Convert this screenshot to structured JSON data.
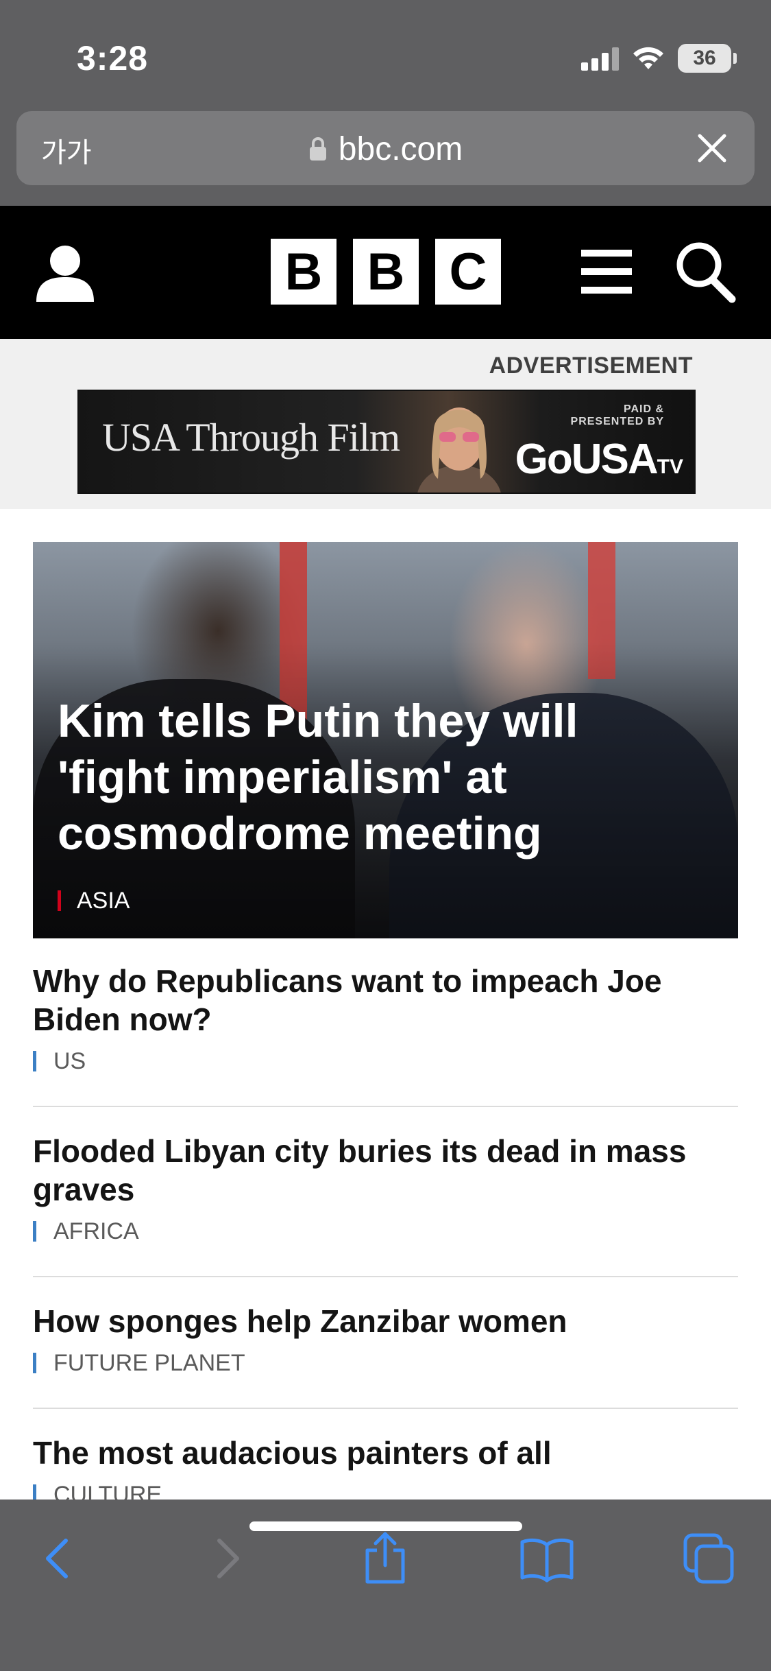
{
  "status_bar": {
    "time": "3:28",
    "battery": "36"
  },
  "browser": {
    "text_size_button": "가가",
    "url": "bbc.com"
  },
  "bbc": {
    "logo_letters": [
      "B",
      "B",
      "C"
    ]
  },
  "advertisement": {
    "label": "ADVERTISEMENT",
    "banner_title": "USA Through Film",
    "paid_line1": "PAID &",
    "paid_line2": "PRESENTED BY",
    "brand": "GoUSA",
    "brand_suffix": "TV"
  },
  "hero": {
    "title": "Kim tells Putin they will 'fight imperialism' at cosmodrome meeting",
    "tag": "ASIA"
  },
  "stories": [
    {
      "title": "Why do Republicans want to impeach Joe Biden now?",
      "tag": "US"
    },
    {
      "title": "Flooded Libyan city buries its dead in mass graves",
      "tag": "AFRICA"
    },
    {
      "title": "How sponges help Zanzibar women",
      "tag": "FUTURE PLANET"
    },
    {
      "title": "The most audacious painters of all",
      "tag": "CULTURE"
    }
  ],
  "colors": {
    "bbc_black": "#000000",
    "asia_tag": "#d0021b",
    "news_tag": "#3b7fc4",
    "toolbar_blue": "#3e8ef7"
  },
  "toolbar_icons": [
    "back-icon",
    "forward-icon",
    "share-icon",
    "bookmarks-icon",
    "tabs-icon"
  ]
}
